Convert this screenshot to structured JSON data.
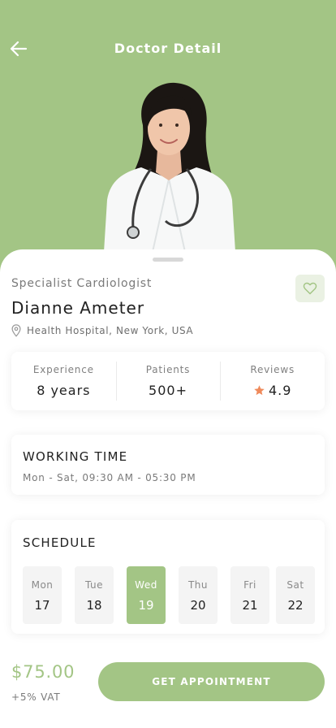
{
  "header": {
    "title": "Doctor Detail"
  },
  "doctor": {
    "specialty": "Specialist Cardiologist",
    "name": "Dianne Ameter",
    "location": "Health Hospital, New York, USA"
  },
  "stats": [
    {
      "label": "Experience",
      "value": "8 years"
    },
    {
      "label": "Patients",
      "value": "500+"
    },
    {
      "label": "Reviews",
      "value": "4.9",
      "icon": "star-icon"
    }
  ],
  "working_time": {
    "title": "WORKING TIME",
    "hours": "Mon - Sat, 09:30 AM - 05:30 PM"
  },
  "schedule": {
    "title": "SCHEDULE",
    "days": [
      {
        "name": "Mon",
        "date": "17"
      },
      {
        "name": "Tue",
        "date": "18"
      },
      {
        "name": "Wed",
        "date": "19",
        "selected": true
      },
      {
        "name": "Thu",
        "date": "20"
      },
      {
        "name": "Fri",
        "date": "21"
      },
      {
        "name": "Sat",
        "date": "22"
      }
    ]
  },
  "footer": {
    "price": "$75.00",
    "vat": "+5% VAT",
    "cta_label": "GET APPOINTMENT"
  },
  "colors": {
    "accent": "#a3c585",
    "star": "#ef8a5b",
    "fav_bg": "#eaf1e3"
  }
}
